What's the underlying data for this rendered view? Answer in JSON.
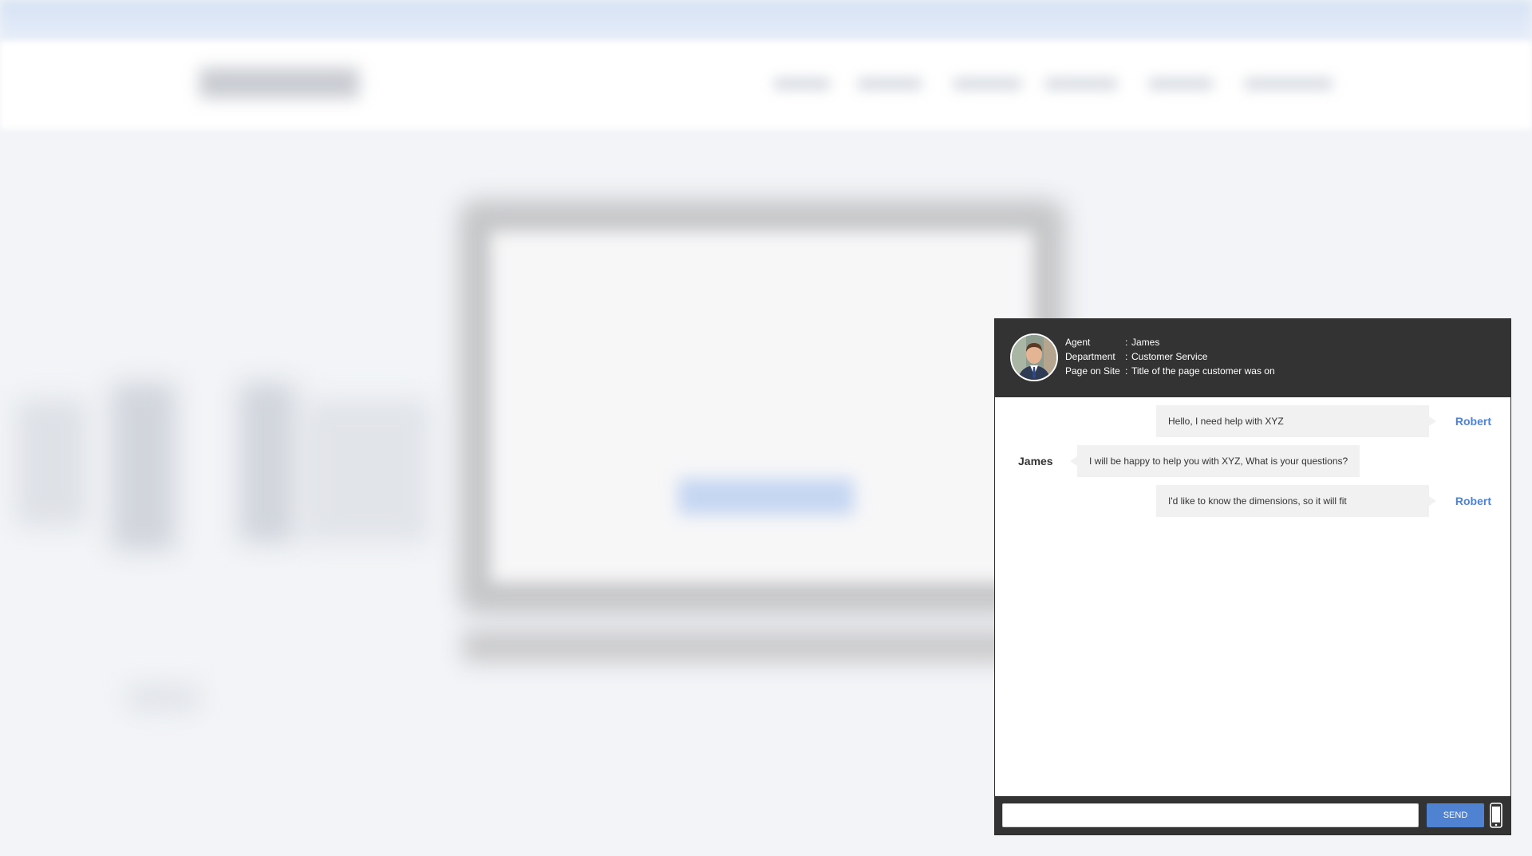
{
  "chat": {
    "agent_info": [
      {
        "label": "Agent",
        "separator": ":",
        "value": "James"
      },
      {
        "label": "Department",
        "separator": ":",
        "value": "Customer Service"
      },
      {
        "label": "Page on Site",
        "separator": ":",
        "value": "Title of the page customer was on"
      }
    ],
    "messages": [
      {
        "sender": "Robert",
        "side": "customer",
        "text": "Hello, I need help with XYZ"
      },
      {
        "sender": "James",
        "side": "agent",
        "text": "I will be happy to help you with XYZ, What is your questions?"
      },
      {
        "sender": "Robert",
        "side": "customer",
        "text": "I'd like to know the dimensions, so it will fit"
      }
    ],
    "input": {
      "value": "",
      "placeholder": ""
    },
    "send_label": "SEND",
    "icons": {
      "avatar": "agent-avatar",
      "device": "mobile-phone-icon"
    }
  },
  "colors": {
    "header_bg": "#333333",
    "accent": "#4f82d1",
    "bubble_bg": "#f1f1f1"
  }
}
